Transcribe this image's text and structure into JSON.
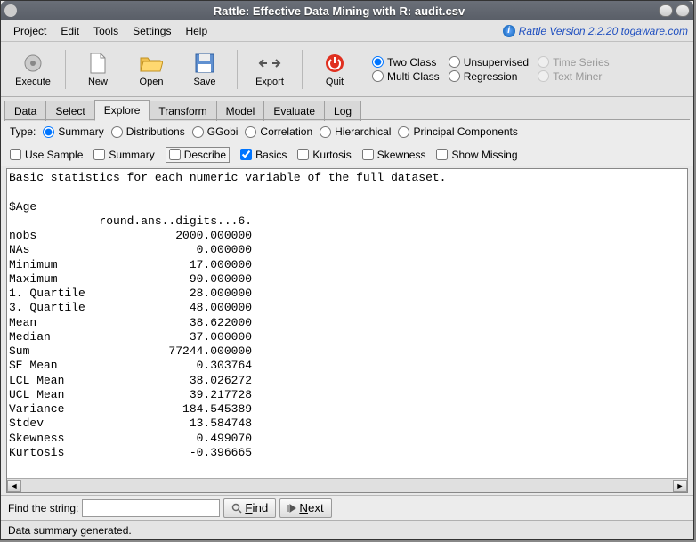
{
  "window": {
    "title": "Rattle: Effective Data Mining with R: audit.csv"
  },
  "menu": {
    "project": "Project",
    "edit": "Edit",
    "tools": "Tools",
    "settings": "Settings",
    "help": "Help",
    "version_prefix": "Rattle Version 2.2.20 ",
    "version_link": "togaware.com"
  },
  "toolbar": {
    "execute": "Execute",
    "new": "New",
    "open": "Open",
    "save": "Save",
    "export": "Export",
    "quit": "Quit"
  },
  "modes": {
    "two_class": "Two Class",
    "unsupervised": "Unsupervised",
    "time_series": "Time Series",
    "multi_class": "Multi Class",
    "regression": "Regression",
    "text_miner": "Text Miner"
  },
  "tabs": {
    "data": "Data",
    "select": "Select",
    "explore": "Explore",
    "transform": "Transform",
    "model": "Model",
    "evaluate": "Evaluate",
    "log": "Log"
  },
  "type": {
    "label": "Type:",
    "summary": "Summary",
    "distributions": "Distributions",
    "ggobi": "GGobi",
    "correlation": "Correlation",
    "hierarchical": "Hierarchical",
    "pc": "Principal Components"
  },
  "opts": {
    "use_sample": "Use Sample",
    "summary": "Summary",
    "describe": "Describe",
    "basics": "Basics",
    "kurtosis": "Kurtosis",
    "skewness": "Skewness",
    "show_missing": "Show Missing"
  },
  "output": {
    "header": "Basic statistics for each numeric variable of the full dataset.",
    "var": "$Age",
    "colhdr": "             round.ans..digits...6.",
    "rows": [
      [
        "nobs",
        "2000.000000"
      ],
      [
        "NAs",
        "0.000000"
      ],
      [
        "Minimum",
        "17.000000"
      ],
      [
        "Maximum",
        "90.000000"
      ],
      [
        "1. Quartile",
        "28.000000"
      ],
      [
        "3. Quartile",
        "48.000000"
      ],
      [
        "Mean",
        "38.622000"
      ],
      [
        "Median",
        "37.000000"
      ],
      [
        "Sum",
        "77244.000000"
      ],
      [
        "SE Mean",
        "0.303764"
      ],
      [
        "LCL Mean",
        "38.026272"
      ],
      [
        "UCL Mean",
        "39.217728"
      ],
      [
        "Variance",
        "184.545389"
      ],
      [
        "Stdev",
        "13.584748"
      ],
      [
        "Skewness",
        "0.499070"
      ],
      [
        "Kurtosis",
        "-0.396665"
      ]
    ]
  },
  "find": {
    "label": "Find the string:",
    "find_btn": "Find",
    "next_btn": "Next",
    "value": ""
  },
  "status": {
    "text": "Data summary generated."
  }
}
